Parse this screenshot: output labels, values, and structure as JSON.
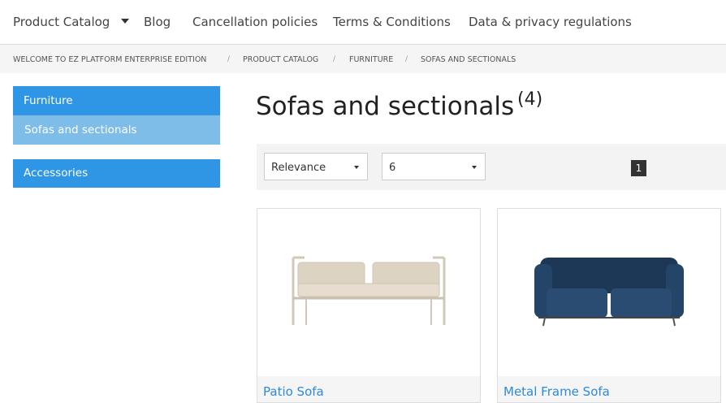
{
  "nav": {
    "items": [
      "Product Catalog",
      "Blog",
      "Cancellation policies",
      "Terms & Conditions",
      "Data & privacy regulations"
    ]
  },
  "breadcrumb": {
    "items": [
      "WELCOME TO EZ PLATFORM ENTERPRISE EDITION",
      "PRODUCT CATALOG",
      "FURNITURE",
      "SOFAS AND SECTIONALS"
    ],
    "separator": "/"
  },
  "sidebar": {
    "furniture": "Furniture",
    "sofas": "Sofas and sectionals",
    "accessories": "Accessories"
  },
  "main": {
    "title": "Sofas and sectionals",
    "count": "(4)"
  },
  "toolbar": {
    "sort_value": "Relevance",
    "per_page_value": "6",
    "current_page": "1"
  },
  "products": [
    {
      "name": "Patio Sofa"
    },
    {
      "name": "Metal Frame Sofa"
    }
  ],
  "colors": {
    "accent": "#2f96e6",
    "accent_light": "#7fbde9",
    "link": "#2e8ad8",
    "sofa1": "#ddd3c3",
    "sofa2": "#1d3856"
  }
}
